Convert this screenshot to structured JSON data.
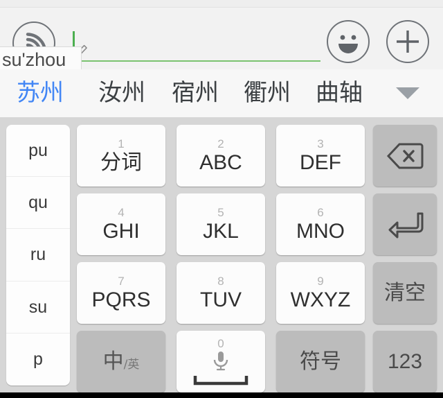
{
  "toolbar": {
    "voice_icon": "voice-signal-icon",
    "emoji_icon": "emoji-smiley-icon",
    "plus_icon": "plus-icon",
    "edit_icon": "pencil-edit-icon",
    "accent_color": "#7ac36f"
  },
  "input": {
    "composing_text": "su'zhou",
    "placeholder": ""
  },
  "candidates": {
    "selected_index": 0,
    "selected_color": "#4286f5",
    "expand_icon": "chevron-down-icon",
    "items": [
      {
        "label": "苏州"
      },
      {
        "label": "汝州"
      },
      {
        "label": "宿州"
      },
      {
        "label": "衢州"
      },
      {
        "label": "曲轴"
      }
    ]
  },
  "keyboard": {
    "pinyin_column": [
      {
        "label": "pu"
      },
      {
        "label": "qu"
      },
      {
        "label": "ru"
      },
      {
        "label": "su"
      },
      {
        "label": "p"
      }
    ],
    "keys": [
      {
        "num": "1",
        "main": "分词"
      },
      {
        "num": "2",
        "main": "ABC"
      },
      {
        "num": "3",
        "main": "DEF"
      },
      {
        "num": "4",
        "main": "GHI"
      },
      {
        "num": "5",
        "main": "JKL"
      },
      {
        "num": "6",
        "main": "MNO"
      },
      {
        "num": "7",
        "main": "PQRS"
      },
      {
        "num": "8",
        "main": "TUV"
      },
      {
        "num": "9",
        "main": "WXYZ"
      }
    ],
    "lang_toggle": {
      "primary": "中",
      "separator": "/",
      "secondary": "英"
    },
    "space_key": {
      "num": "0",
      "icon": "microphone-icon",
      "bar_icon": "space-bar-icon"
    },
    "symbol_key": {
      "label": "符号"
    },
    "backspace_key": {
      "icon": "backspace-icon"
    },
    "enter_key": {
      "icon": "enter-return-icon"
    },
    "clear_key": {
      "label": "清空"
    },
    "numeric_key": {
      "label": "123"
    }
  }
}
